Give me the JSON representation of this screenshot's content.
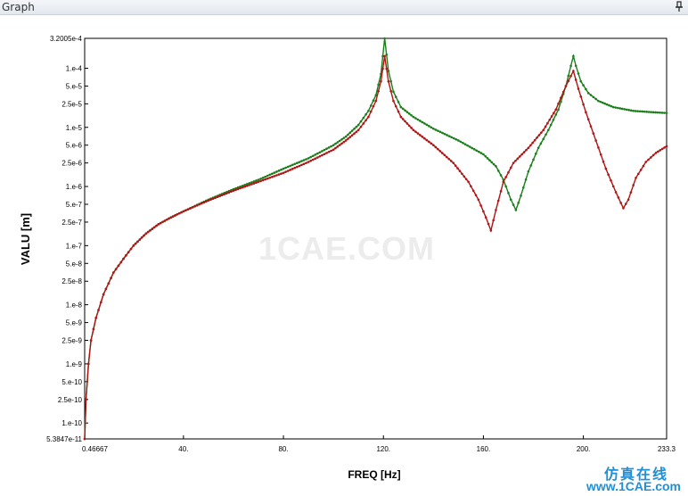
{
  "window": {
    "title": "Graph",
    "pin_icon": "pin-icon"
  },
  "watermark": {
    "center": "1CAE.COM",
    "cn": "仿真在线",
    "url": "www.1CAE.com"
  },
  "chart_data": {
    "type": "line",
    "xlabel": "FREQ [Hz]",
    "ylabel": "VALU [m]",
    "xlim": [
      0.46667,
      233.3
    ],
    "ylim": [
      5.3847e-11,
      0.00032005
    ],
    "yscale": "log",
    "grid": false,
    "xticks": [
      {
        "value": 0.46667,
        "label": "0.46667"
      },
      {
        "value": 40,
        "label": "40."
      },
      {
        "value": 80,
        "label": "80."
      },
      {
        "value": 120,
        "label": "120."
      },
      {
        "value": 160,
        "label": "160."
      },
      {
        "value": 200,
        "label": "200."
      },
      {
        "value": 233.3,
        "label": "233.3"
      }
    ],
    "yticks": [
      {
        "value": 0.00032005,
        "label": "3.2005e-4"
      },
      {
        "value": 0.0001,
        "label": "1.e-4"
      },
      {
        "value": 5e-05,
        "label": "5.e-5"
      },
      {
        "value": 2.5e-05,
        "label": "2.5e-5"
      },
      {
        "value": 1e-05,
        "label": "1.e-5"
      },
      {
        "value": 5e-06,
        "label": "5.e-6"
      },
      {
        "value": 2.5e-06,
        "label": "2.5e-6"
      },
      {
        "value": 1e-06,
        "label": "1.e-6"
      },
      {
        "value": 5e-07,
        "label": "5.e-7"
      },
      {
        "value": 2.5e-07,
        "label": "2.5e-7"
      },
      {
        "value": 1e-07,
        "label": "1.e-7"
      },
      {
        "value": 5e-08,
        "label": "5.e-8"
      },
      {
        "value": 2.5e-08,
        "label": "2.5e-8"
      },
      {
        "value": 1e-08,
        "label": "1.e-8"
      },
      {
        "value": 5e-09,
        "label": "5.e-9"
      },
      {
        "value": 2.5e-09,
        "label": "2.5e-9"
      },
      {
        "value": 1e-09,
        "label": "1.e-9"
      },
      {
        "value": 5e-10,
        "label": "5.e-10"
      },
      {
        "value": 2.5e-10,
        "label": "2.5e-10"
      },
      {
        "value": 1e-10,
        "label": "1.e-10"
      },
      {
        "value": 5.3847e-11,
        "label": "5.3847e-11"
      }
    ],
    "series": [
      {
        "color": "#1a7f1a",
        "points": [
          [
            0.46667,
            5.3847e-11
          ],
          [
            1.0,
            2.5e-10
          ],
          [
            2.0,
            1e-09
          ],
          [
            3.0,
            2.5e-09
          ],
          [
            5.0,
            6e-09
          ],
          [
            8.0,
            1.5e-08
          ],
          [
            12.0,
            3.5e-08
          ],
          [
            16.0,
            6e-08
          ],
          [
            20.0,
            1e-07
          ],
          [
            25.0,
            1.6e-07
          ],
          [
            30.0,
            2.3e-07
          ],
          [
            35.0,
            3e-07
          ],
          [
            40.0,
            3.8e-07
          ],
          [
            50.0,
            6e-07
          ],
          [
            60.0,
            9e-07
          ],
          [
            70.0,
            1.3e-06
          ],
          [
            80.0,
            2e-06
          ],
          [
            90.0,
            3e-06
          ],
          [
            100.0,
            5e-06
          ],
          [
            105.0,
            7e-06
          ],
          [
            110.0,
            1.1e-05
          ],
          [
            114.0,
            1.9e-05
          ],
          [
            117.0,
            3.5e-05
          ],
          [
            119.0,
            8e-05
          ],
          [
            120.5,
            0.00032
          ],
          [
            122.0,
            9e-05
          ],
          [
            124.0,
            4e-05
          ],
          [
            127.0,
            2.2e-05
          ],
          [
            132.0,
            1.5e-05
          ],
          [
            140.0,
            9.5e-06
          ],
          [
            150.0,
            6e-06
          ],
          [
            160.0,
            3.5e-06
          ],
          [
            165.0,
            2.2e-06
          ],
          [
            168.0,
            1.3e-06
          ],
          [
            171.0,
            6e-07
          ],
          [
            173.0,
            4e-07
          ],
          [
            175.0,
            7e-07
          ],
          [
            178.0,
            1.8e-06
          ],
          [
            182.0,
            4.5e-06
          ],
          [
            186.0,
            9e-06
          ],
          [
            190.0,
            2e-05
          ],
          [
            193.0,
            5e-05
          ],
          [
            195.0,
            0.00011
          ],
          [
            196.0,
            0.00016
          ],
          [
            197.0,
            0.00011
          ],
          [
            199.0,
            6e-05
          ],
          [
            202.0,
            3.8e-05
          ],
          [
            206.0,
            2.8e-05
          ],
          [
            212.0,
            2.2e-05
          ],
          [
            220.0,
            1.9e-05
          ],
          [
            228.0,
            1.8e-05
          ],
          [
            233.3,
            1.75e-05
          ]
        ]
      },
      {
        "color": "#b01515",
        "points": [
          [
            0.46667,
            5.3847e-11
          ],
          [
            1.0,
            2.5e-10
          ],
          [
            2.0,
            1e-09
          ],
          [
            3.0,
            2.5e-09
          ],
          [
            5.0,
            6e-09
          ],
          [
            8.0,
            1.5e-08
          ],
          [
            12.0,
            3.5e-08
          ],
          [
            16.0,
            6e-08
          ],
          [
            20.0,
            1e-07
          ],
          [
            25.0,
            1.6e-07
          ],
          [
            30.0,
            2.3e-07
          ],
          [
            35.0,
            3e-07
          ],
          [
            40.0,
            3.8e-07
          ],
          [
            50.0,
            5.8e-07
          ],
          [
            60.0,
            8.5e-07
          ],
          [
            70.0,
            1.2e-06
          ],
          [
            80.0,
            1.7e-06
          ],
          [
            90.0,
            2.6e-06
          ],
          [
            100.0,
            4.2e-06
          ],
          [
            105.0,
            6e-06
          ],
          [
            110.0,
            9e-06
          ],
          [
            114.0,
            1.5e-05
          ],
          [
            117.0,
            2.8e-05
          ],
          [
            119.0,
            6e-05
          ],
          [
            120.5,
            0.00016
          ],
          [
            122.0,
            6e-05
          ],
          [
            124.0,
            2.8e-05
          ],
          [
            127.0,
            1.5e-05
          ],
          [
            132.0,
            9e-06
          ],
          [
            140.0,
            5e-06
          ],
          [
            148.0,
            2.5e-06
          ],
          [
            154.0,
            1.2e-06
          ],
          [
            158.0,
            6e-07
          ],
          [
            161.0,
            3e-07
          ],
          [
            163.0,
            1.8e-07
          ],
          [
            165.0,
            4e-07
          ],
          [
            168.0,
            1.2e-06
          ],
          [
            172.0,
            2.5e-06
          ],
          [
            178.0,
            4.5e-06
          ],
          [
            184.0,
            9e-06
          ],
          [
            189.0,
            2e-05
          ],
          [
            193.0,
            5e-05
          ],
          [
            196.0,
            9e-05
          ],
          [
            198.0,
            4.5e-05
          ],
          [
            201.0,
            1.8e-05
          ],
          [
            205.0,
            6e-06
          ],
          [
            209.0,
            2e-06
          ],
          [
            213.0,
            8e-07
          ],
          [
            216.0,
            4.3e-07
          ],
          [
            218.0,
            6e-07
          ],
          [
            221.0,
            1.4e-06
          ],
          [
            225.0,
            2.6e-06
          ],
          [
            229.0,
            3.7e-06
          ],
          [
            233.3,
            4.8e-06
          ]
        ]
      }
    ]
  }
}
